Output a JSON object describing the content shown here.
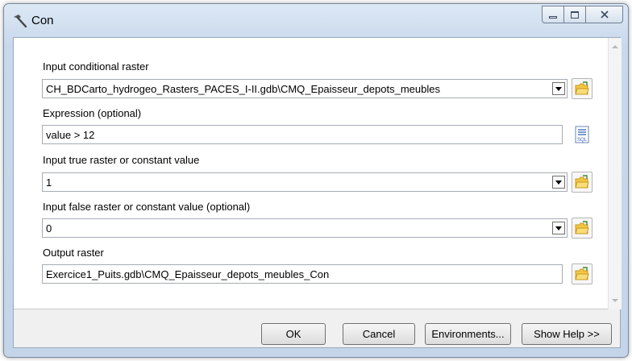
{
  "window": {
    "title": "Con",
    "icon": "hammer-icon"
  },
  "params": {
    "input_conditional_raster": {
      "label": "Input conditional raster",
      "value": "CH_BDCarto_hydrogeo_Rasters_PACES_I-II.gdb\\CMQ_Epaisseur_depots_meubles"
    },
    "expression": {
      "label": "Expression (optional)",
      "value": "value > 12"
    },
    "input_true": {
      "label": "Input true raster or constant value",
      "value": "1"
    },
    "input_false": {
      "label": "Input false raster or constant value (optional)",
      "value": "0"
    },
    "output_raster": {
      "label": "Output raster",
      "value": "Exercice1_Puits.gdb\\CMQ_Epaisseur_depots_meubles_Con"
    }
  },
  "buttons": {
    "ok": "OK",
    "cancel": "Cancel",
    "environments": "Environments...",
    "show_help": "Show Help >>"
  },
  "sql_icon_text": "SQL",
  "colors": {
    "folder_yellow": "#f2c744",
    "folder_edge": "#c89a1c",
    "sql_blue": "#2b5fb0"
  }
}
